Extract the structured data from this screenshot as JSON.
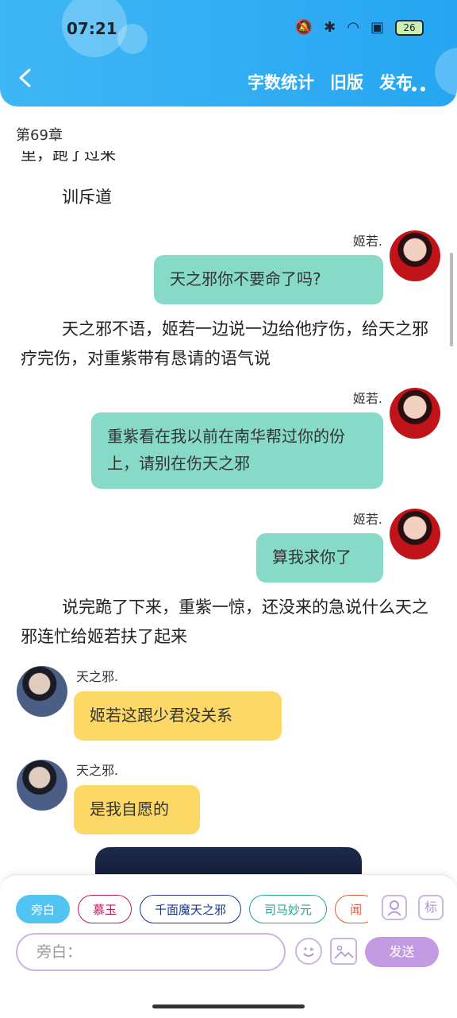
{
  "status_bar": {
    "time": "07:21",
    "battery": "26"
  },
  "header": {
    "actions": [
      "字数统计",
      "旧版",
      "发布"
    ]
  },
  "chapter": {
    "title": "第69章"
  },
  "story": {
    "cut_line": "里，跑了过来",
    "para1": "训斥道",
    "msg1": {
      "speaker": "姬若.",
      "text": "天之邪你不要命了吗?"
    },
    "para2": "天之邪不语，姬若一边说一边给他疗伤，给天之邪疗完伤，对重紫带有恳请的语气说",
    "msg2": {
      "speaker": "姬若.",
      "text": "重紫看在我以前在南华帮过你的份上，请别在伤天之邪"
    },
    "msg3": {
      "speaker": "姬若.",
      "text": "算我求你了"
    },
    "para3": "说完跪了下来，重紫一惊，还没来的急说什么天之邪连忙给姬若扶了起来",
    "msg4": {
      "speaker": "天之邪.",
      "text": "姬若这跟少君没关系"
    },
    "msg5": {
      "speaker": "天之邪.",
      "text": "是我自愿的"
    }
  },
  "composer": {
    "chips": [
      {
        "label": "旁白",
        "color": "#52c4f4"
      },
      {
        "label": "慕玉",
        "color": "#c2185b"
      },
      {
        "label": "千面魔天之邪",
        "color": "#1a3a8a"
      },
      {
        "label": "司马妙元",
        "color": "#26a69a"
      },
      {
        "label": "闻",
        "color": "#e25c3a"
      }
    ],
    "input_placeholder": "旁白：",
    "send_label": "发送",
    "icons": [
      "role-icon",
      "tag-icon",
      "emoji-icon",
      "image-icon"
    ],
    "tag_label": "标"
  },
  "colors": {
    "accent": "#26a6f2",
    "green_bubble": "#87d9c8",
    "yellow_bubble": "#fcd866",
    "purple": "#c39be3"
  }
}
